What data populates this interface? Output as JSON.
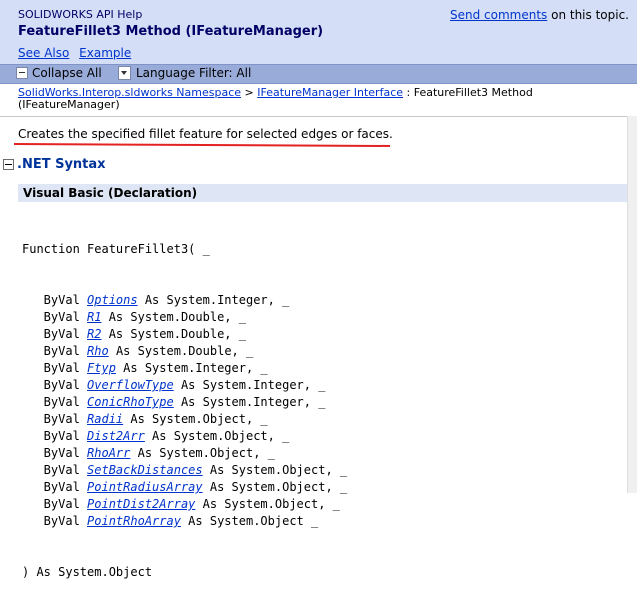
{
  "header": {
    "app_title": "SOLIDWORKS API Help",
    "send_comments_link": "Send comments",
    "send_comments_suffix": " on this topic.",
    "page_title": "FeatureFillet3 Method (IFeatureManager)",
    "see_also": "See Also",
    "example": "Example"
  },
  "toolbar": {
    "collapse_all": "Collapse All",
    "language_filter": "Language Filter: All"
  },
  "breadcrumb": {
    "namespace_link": "SolidWorks.Interop.sldworks Namespace",
    "sep1": " > ",
    "interface_link": "IFeatureManager Interface",
    "current": " : FeatureFillet3 Method (IFeatureManager)"
  },
  "content": {
    "description": "Creates the specified fillet feature for selected edges or faces.",
    "section_title": ".NET Syntax",
    "syntax_header": "Visual Basic (Declaration)",
    "code_first": "Function FeatureFillet3( _",
    "params": [
      {
        "prefix": "   ByVal ",
        "name": "Options",
        "suffix": " As System.Integer, _"
      },
      {
        "prefix": "   ByVal ",
        "name": "R1",
        "suffix": " As System.Double, _"
      },
      {
        "prefix": "   ByVal ",
        "name": "R2",
        "suffix": " As System.Double, _"
      },
      {
        "prefix": "   ByVal ",
        "name": "Rho",
        "suffix": " As System.Double, _"
      },
      {
        "prefix": "   ByVal ",
        "name": "Ftyp",
        "suffix": " As System.Integer, _"
      },
      {
        "prefix": "   ByVal ",
        "name": "OverflowType",
        "suffix": " As System.Integer, _"
      },
      {
        "prefix": "   ByVal ",
        "name": "ConicRhoType",
        "suffix": " As System.Integer, _"
      },
      {
        "prefix": "   ByVal ",
        "name": "Radii",
        "suffix": " As System.Object, _"
      },
      {
        "prefix": "   ByVal ",
        "name": "Dist2Arr",
        "suffix": " As System.Object, _"
      },
      {
        "prefix": "   ByVal ",
        "name": "RhoArr",
        "suffix": " As System.Object, _"
      },
      {
        "prefix": "   ByVal ",
        "name": "SetBackDistances",
        "suffix": " As System.Object, _"
      },
      {
        "prefix": "   ByVal ",
        "name": "PointRadiusArray",
        "suffix": " As System.Object, _"
      },
      {
        "prefix": "   ByVal ",
        "name": "PointDist2Array",
        "suffix": " As System.Object, _"
      },
      {
        "prefix": "   ByVal ",
        "name": "PointRhoArray",
        "suffix": " As System.Object _"
      }
    ],
    "code_last": ") As System.Object"
  },
  "colors": {
    "header_bg": "#d4dff7",
    "toolbar_bg": "#99acd9",
    "link": "#0033cc",
    "title": "#000066",
    "annotation_underline": "#e32222"
  }
}
